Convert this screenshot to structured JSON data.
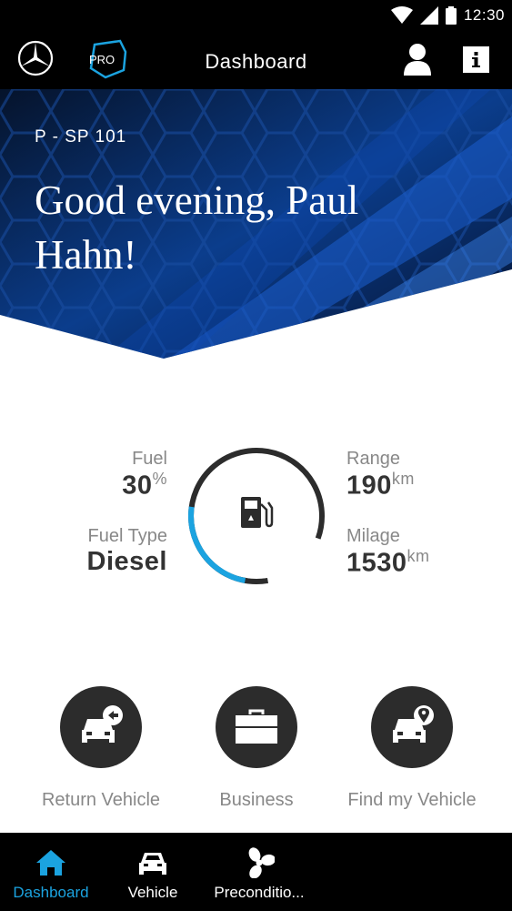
{
  "status_bar": {
    "time": "12:30"
  },
  "app_bar": {
    "title": "Dashboard",
    "brand_badge": "PRO"
  },
  "hero": {
    "plate": "P - SP 101",
    "greeting": "Good evening, Paul Hahn!"
  },
  "stats": {
    "fuel": {
      "label": "Fuel",
      "value": "30",
      "unit": "%"
    },
    "fuel_type": {
      "label": "Fuel Type",
      "value": "Diesel"
    },
    "range": {
      "label": "Range",
      "value": "190",
      "unit": "km"
    },
    "milage": {
      "label": "Milage",
      "value": "1530",
      "unit": "km"
    }
  },
  "gauge": {
    "fuel_level": 0.3,
    "accent_color": "#1ba3e0",
    "track_color": "#2c2c2c",
    "icon": "fuel-pump-icon"
  },
  "actions": [
    {
      "label": "Return Vehicle",
      "icon": "return-vehicle-icon"
    },
    {
      "label": "Business",
      "icon": "briefcase-icon"
    },
    {
      "label": "Find my Vehicle",
      "icon": "find-vehicle-icon"
    }
  ],
  "bottom_nav": {
    "items": [
      {
        "label": "Dashboard",
        "icon": "home-icon",
        "active": true
      },
      {
        "label": "Vehicle",
        "icon": "car-icon",
        "active": false
      },
      {
        "label": "Preconditio...",
        "icon": "fan-icon",
        "active": false
      }
    ]
  }
}
